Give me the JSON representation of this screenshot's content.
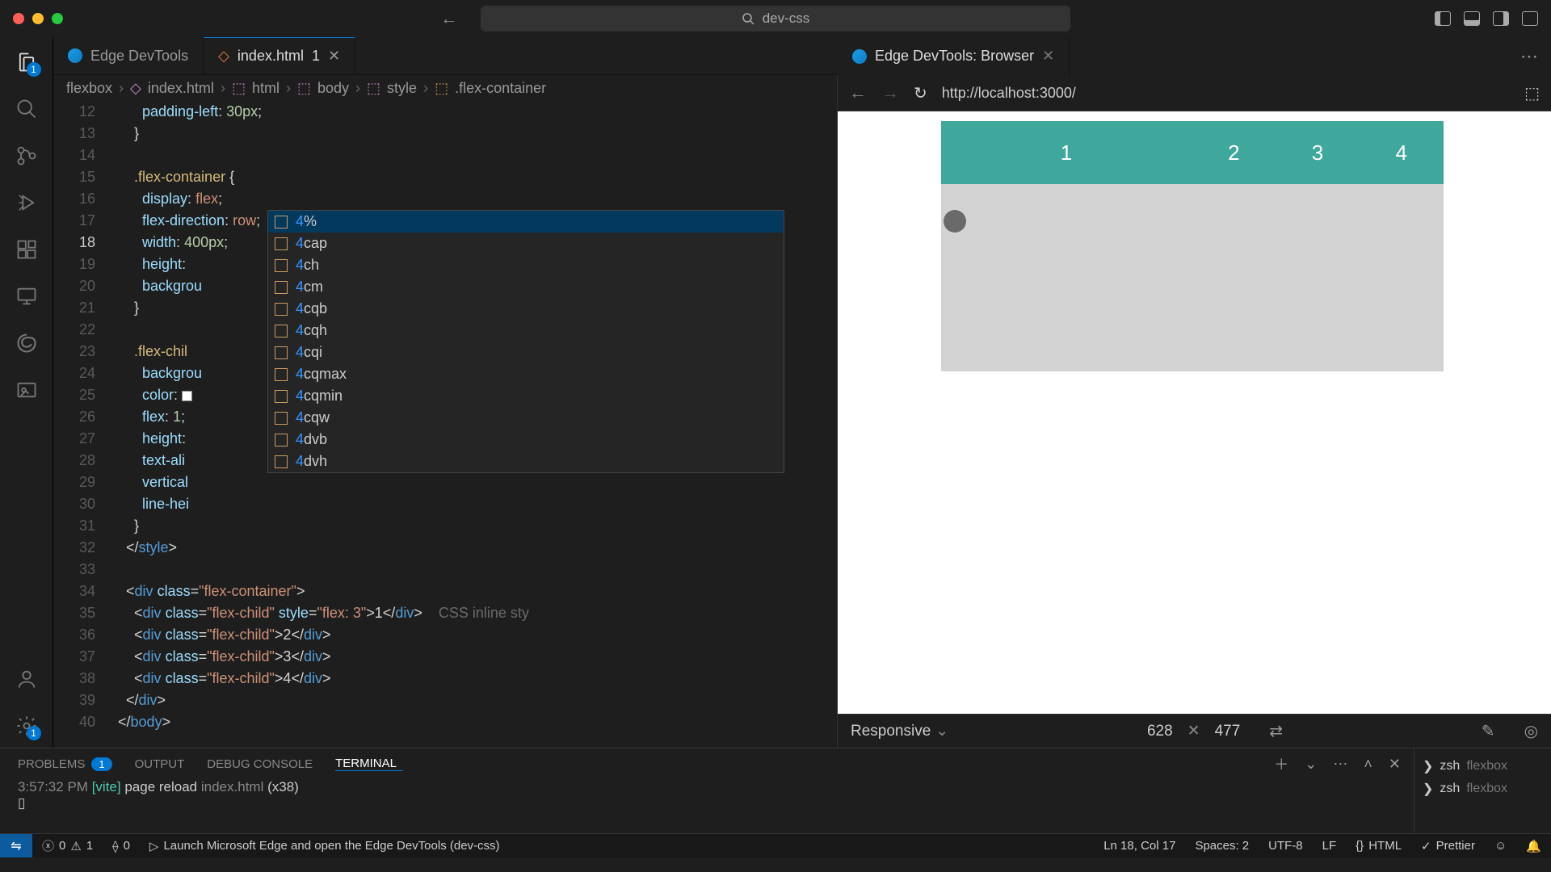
{
  "title": {
    "search": "dev-css"
  },
  "activity": {
    "badge": "1"
  },
  "tabs": {
    "devtools": "Edge DevTools",
    "file": "index.html",
    "mod": "1",
    "browser": "Edge DevTools: Browser"
  },
  "breadcrumb": {
    "folder": "flexbox",
    "file": "index.html",
    "html": "html",
    "body": "body",
    "style": "style",
    "selector": ".flex-container"
  },
  "code": {
    "l12a": "padding-left",
    "l12b": "30px",
    "l15a": ".flex-container",
    "l15b": "{",
    "l16a": "display",
    "l16b": "flex",
    "l17a": "flex-direction",
    "l17b": "row",
    "l18a": "width",
    "l18b": "400px",
    "l19a": "height",
    "l20a": "backgrou",
    "l23a": ".flex-chil",
    "l24a": "backgrou",
    "l25a": "color",
    "l26a": "flex",
    "l26b": "1",
    "l27a": "height",
    "l28a": "text-ali",
    "l29a": "vertical",
    "l30a": "line-hei",
    "l32": "style",
    "l34a": "div",
    "l34b": "class",
    "l34c": "flex-container",
    "l35a": "div",
    "l35b": "class",
    "l35c": "flex-child",
    "l35d": "style",
    "l35e": "flex: 3",
    "l35f": "1",
    "l35hint": "CSS inline sty",
    "l36c": "flex-child",
    "l36f": "2",
    "l37f": "3",
    "l38f": "4",
    "l39": "div",
    "l40": "body"
  },
  "suggest": {
    "items": [
      "4%",
      "4cap",
      "4ch",
      "4cm",
      "4cqb",
      "4cqh",
      "4cqi",
      "4cqmax",
      "4cqmin",
      "4cqw",
      "4dvb",
      "4dvh"
    ]
  },
  "browser": {
    "url": "http://localhost:3000/",
    "dim_label": "Responsive",
    "w": "628",
    "h": "477",
    "cells": [
      "1",
      "2",
      "3",
      "4"
    ]
  },
  "panel": {
    "tabs": {
      "problems": "PROBLEMS",
      "problems_badge": "1",
      "output": "OUTPUT",
      "debug": "DEBUG CONSOLE",
      "terminal": "TERMINAL"
    },
    "log": {
      "time": "3:57:32 PM",
      "vite": "[vite]",
      "msg": "page reload",
      "file": "index.html",
      "count": "(x38)"
    },
    "side": {
      "shell": "zsh",
      "dir": "flexbox"
    }
  },
  "status": {
    "err": "0",
    "warn": "1",
    "port": "0",
    "launch": "Launch Microsoft Edge and open the Edge DevTools (dev-css)",
    "pos": "Ln 18, Col 17",
    "spaces": "Spaces: 2",
    "enc": "UTF-8",
    "eol": "LF",
    "lang": "HTML",
    "prettier": "Prettier"
  },
  "lines": [
    "12",
    "13",
    "14",
    "15",
    "16",
    "17",
    "18",
    "19",
    "20",
    "21",
    "22",
    "23",
    "24",
    "25",
    "26",
    "27",
    "28",
    "29",
    "30",
    "31",
    "32",
    "33",
    "34",
    "35",
    "36",
    "37",
    "38",
    "39",
    "40"
  ]
}
